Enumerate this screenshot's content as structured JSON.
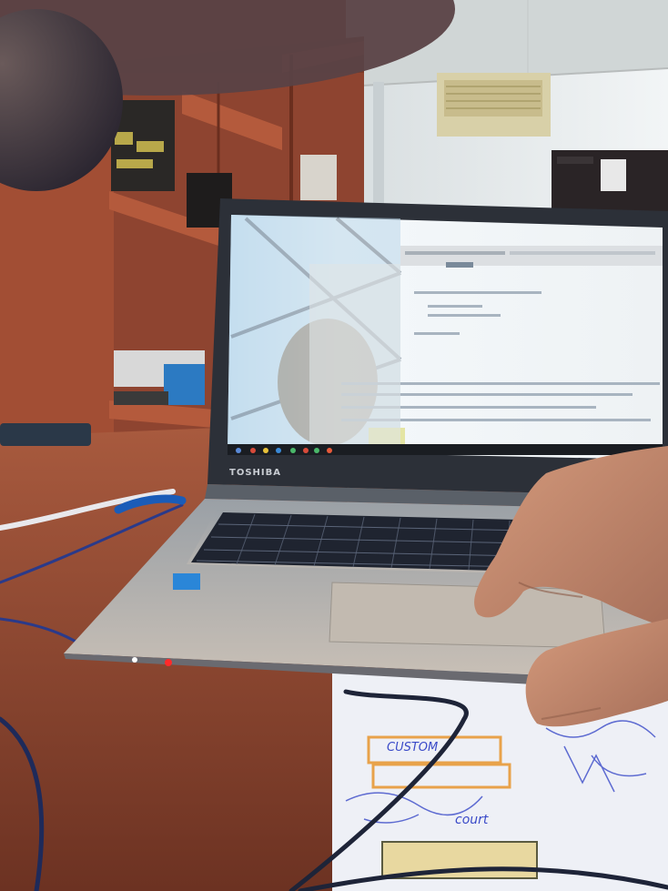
{
  "scene": {
    "kind": "photo",
    "laptop_brand": "TOSHIBA",
    "paper_note_top": "CUSTOM",
    "paper_note_bottom": "court",
    "colors": {
      "desk": "#a4543a",
      "desk_dark": "#7a3a26",
      "shelf": "#9a4a32",
      "wall": "#e6ecee",
      "screen": "#eef3f6",
      "laptop_body": "#b8b0a8",
      "keyboard": "#1f2430",
      "cable": "#2a3a6a",
      "paper": "#f2f4f8",
      "skin": "#c48a6a",
      "led_red": "#ff2a2a",
      "led_white": "#ffffff"
    }
  }
}
